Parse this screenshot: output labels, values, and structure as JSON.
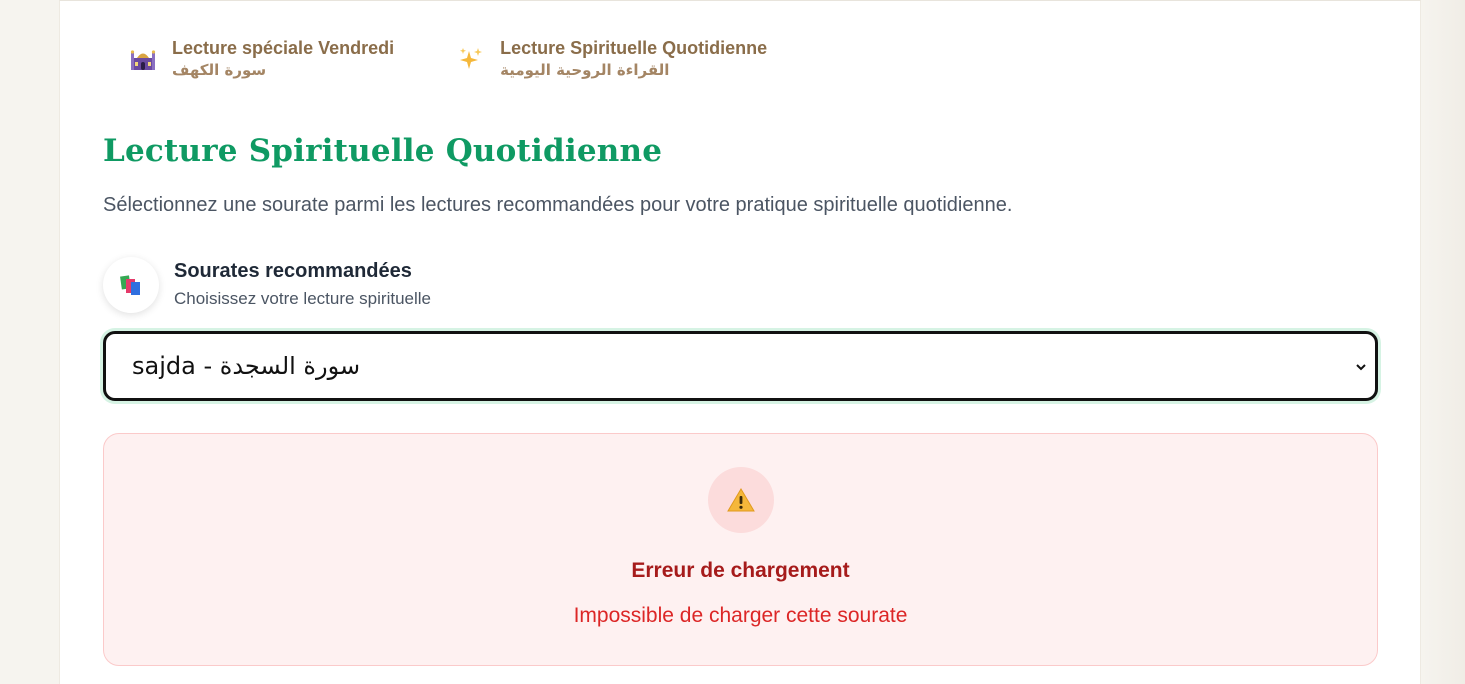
{
  "tabs": [
    {
      "title": "Lecture spéciale Vendredi",
      "subtitle": "سورة الكهف",
      "icon": "mosque-icon"
    },
    {
      "title": "Lecture Spirituelle Quotidienne",
      "subtitle": "القراءة الروحية اليومية",
      "icon": "sparkles-icon"
    }
  ],
  "page": {
    "title": "Lecture Spirituelle Quotidienne",
    "description": "Sélectionnez une sourate parmi les lectures recommandées pour votre pratique spirituelle quotidienne."
  },
  "section": {
    "title": "Sourates recommandées",
    "subtitle": "Choisissez votre lecture spirituelle",
    "icon": "books-icon"
  },
  "surah_select": {
    "selected_value": "sajda - سورة السجدة",
    "icon": "chevron-down-icon"
  },
  "error": {
    "title": "Erreur de chargement",
    "message": "Impossible de charger cette sourate",
    "icon": "warning-icon"
  },
  "colors": {
    "accent_green": "#0f9a63",
    "tab_brown": "#8a6d4a",
    "error_red": "#dc2626",
    "error_bg": "#fef1f1"
  }
}
